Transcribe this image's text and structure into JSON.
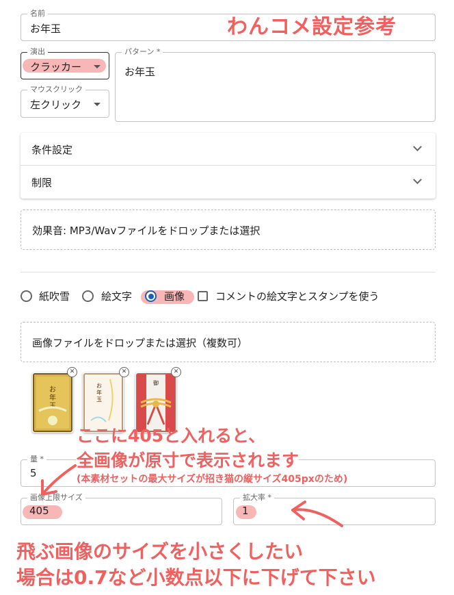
{
  "name_field": {
    "label": "名前",
    "value": "お年玉"
  },
  "effect_field": {
    "label": "演出",
    "value": "クラッカー"
  },
  "pattern_field": {
    "label": "パターン *",
    "value": "お年玉"
  },
  "mouse_field": {
    "label": "マウスクリック",
    "value": "左クリック"
  },
  "accordion": [
    {
      "label": "条件設定"
    },
    {
      "label": "制限"
    }
  ],
  "sound_dropzone": "効果音: MP3/Wavファイルをドロップまたは選択",
  "type_options": {
    "confetti": "紙吹雪",
    "emoji": "絵文字",
    "image": "画像",
    "use_comment": "コメントの絵文字とスタンプを使う",
    "selected": "画像"
  },
  "image_dropzone": "画像ファイルをドロップまたは選択（複数可）",
  "thumbnails": [
    {
      "icon": "otoshidama-envelope-gold-icon"
    },
    {
      "icon": "otoshidama-envelope-white-icon"
    },
    {
      "icon": "goshugi-envelope-red-icon"
    }
  ],
  "amount_field": {
    "label": "量 *",
    "value": "5"
  },
  "max_size_field": {
    "label": "画像上限サイズ",
    "value": "405"
  },
  "scale_field": {
    "label": "拡大率 *",
    "value": "1"
  },
  "annotations": {
    "title": "わんコメ設定参考",
    "note1_line1": "ここに405と入れると、",
    "note1_line2": "全画像が原寸で表示されます",
    "note1_line3": "(本素材セットの最大サイズが招き猫の縦サイズ405pxのため)",
    "note2_line1": "飛ぶ画像のサイズを小さくしたい",
    "note2_line2": "場合は0.7など小数点以下に下げて下さい"
  },
  "colors": {
    "annotation": "#f0605f",
    "highlight": "#f7aaaa",
    "radio_selected": "#1a5fb4"
  }
}
